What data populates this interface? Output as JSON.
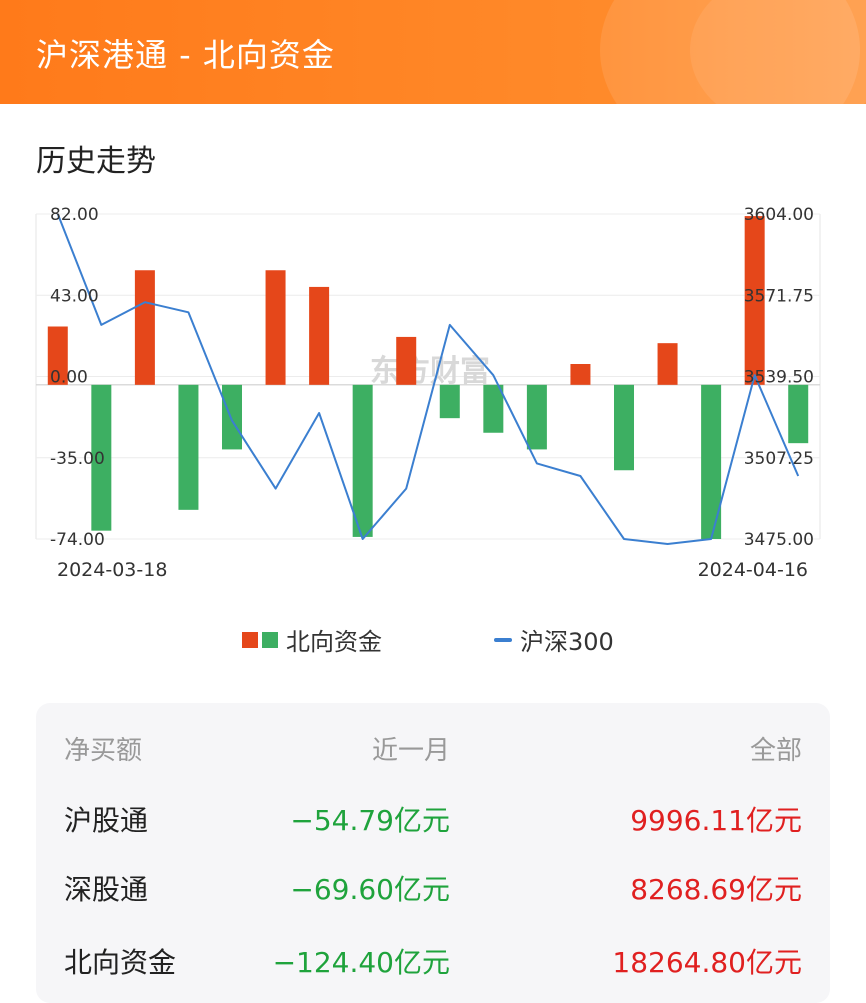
{
  "header": {
    "title": "沪深港通 - 北向资金"
  },
  "section": {
    "title": "历史走势"
  },
  "chart": {
    "left_ticks": [
      "82.00",
      "43.00",
      "0.00",
      "-35.00",
      "-74.00"
    ],
    "right_ticks": [
      "3604.00",
      "3571.75",
      "3539.50",
      "3507.25",
      "3475.00"
    ],
    "start_date": "2024-03-18",
    "end_date": "2024-04-16",
    "watermark": "东方财富",
    "colors": {
      "positive": "#e5471a",
      "negative": "#3daf62",
      "line": "#3b7fd0"
    }
  },
  "chart_data": {
    "type": "bar",
    "title": "历史走势",
    "x": [
      "2024-03-18",
      "",
      "",
      "",
      "",
      "",
      "",
      "",
      "",
      "",
      "",
      "",
      "",
      "",
      "",
      "",
      "",
      "",
      "",
      "2024-04-16"
    ],
    "left_ylim": [
      -74,
      82
    ],
    "right_ylim": [
      3475,
      3604
    ],
    "series": [
      {
        "name": "北向资金",
        "type": "bar",
        "values": [
          28,
          -70,
          55,
          -60,
          -31,
          55,
          47,
          -73,
          23,
          -16,
          -23,
          -31,
          10,
          -41,
          20,
          -74,
          81,
          -28
        ]
      },
      {
        "name": "沪深300",
        "type": "line",
        "axis": "right",
        "values": [
          3604,
          3560,
          3569,
          3565,
          3522,
          3495,
          3525,
          3475,
          3495,
          3560,
          3540,
          3505,
          3500,
          3475,
          3473,
          3475,
          3540,
          3500
        ]
      }
    ],
    "legend_position": "bottom"
  },
  "legend": {
    "bars": "北向资金",
    "line": "沪深300"
  },
  "table": {
    "headers": [
      "净买额",
      "近一月",
      "全部"
    ],
    "rows": [
      {
        "name": "沪股通",
        "month": "−54.79亿元",
        "total": "9996.11亿元"
      },
      {
        "name": "深股通",
        "month": "−69.60亿元",
        "total": "8268.69亿元"
      },
      {
        "name": "北向资金",
        "month": "−124.40亿元",
        "total": "18264.80亿元"
      }
    ]
  }
}
